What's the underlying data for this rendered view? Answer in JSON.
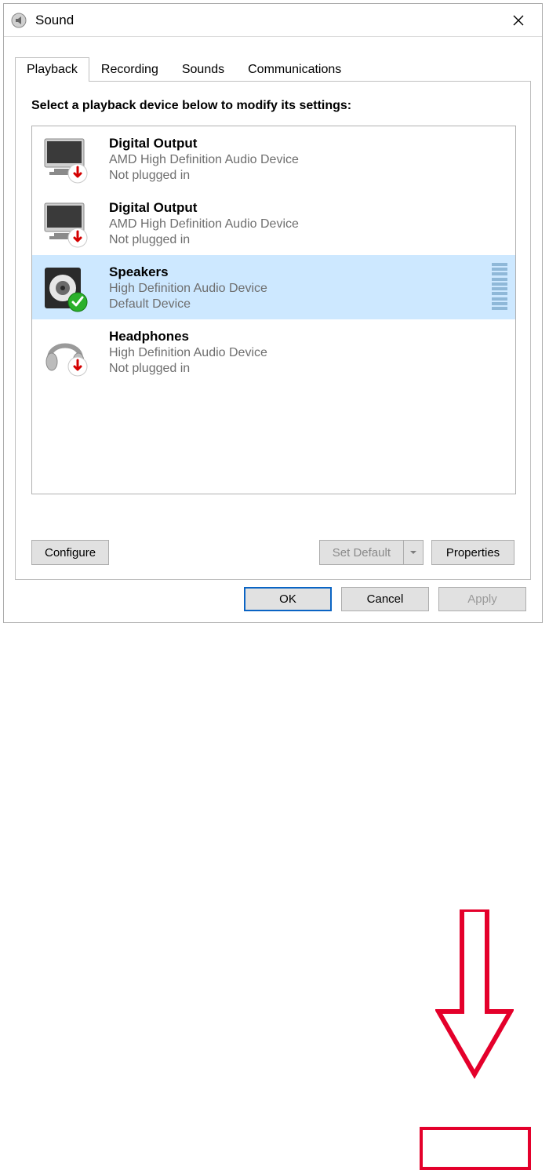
{
  "window": {
    "title": "Sound"
  },
  "tabs": [
    {
      "label": "Playback",
      "active": true
    },
    {
      "label": "Recording",
      "active": false
    },
    {
      "label": "Sounds",
      "active": false
    },
    {
      "label": "Communications",
      "active": false
    }
  ],
  "instruction": "Select a playback device below to modify its settings:",
  "devices": [
    {
      "name": "Digital Output",
      "description": "AMD High Definition Audio Device",
      "status": "Not plugged in",
      "icon": "monitor",
      "badge": "unplugged",
      "selected": false
    },
    {
      "name": "Digital Output",
      "description": "AMD High Definition Audio Device",
      "status": "Not plugged in",
      "icon": "monitor",
      "badge": "unplugged",
      "selected": false
    },
    {
      "name": "Speakers",
      "description": "High Definition Audio Device",
      "status": "Default Device",
      "icon": "speaker",
      "badge": "default",
      "selected": true
    },
    {
      "name": "Headphones",
      "description": "High Definition Audio Device",
      "status": "Not plugged in",
      "icon": "headphones",
      "badge": "unplugged",
      "selected": false
    }
  ],
  "buttons": {
    "configure": "Configure",
    "setDefault": "Set Default",
    "properties": "Properties",
    "ok": "OK",
    "cancel": "Cancel",
    "apply": "Apply"
  }
}
